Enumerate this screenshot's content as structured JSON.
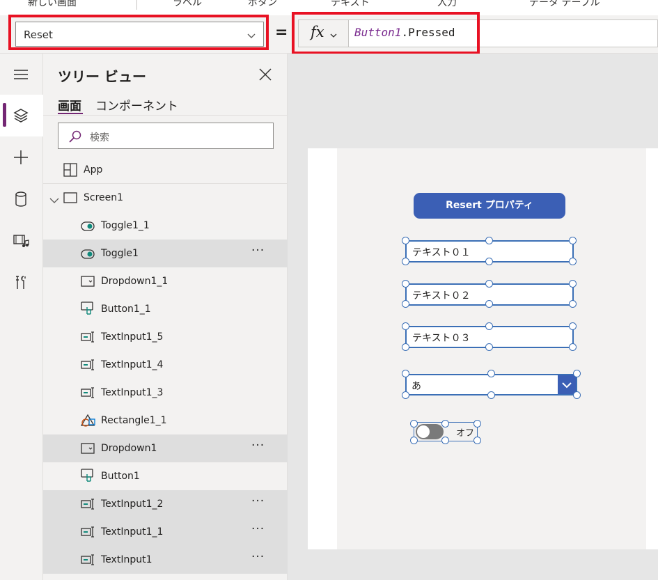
{
  "ribbon": {
    "items": [
      "新しい画面",
      "ラベル",
      "ボタン",
      "テキスト",
      "入力",
      "データ テーブル"
    ]
  },
  "formula_bar": {
    "property": "Reset",
    "equals": "=",
    "fx_label": "fx",
    "formula_control": "Button1",
    "formula_property": ".Pressed"
  },
  "rail": {
    "icons": [
      "hamburger-icon",
      "layers-icon",
      "plus-icon",
      "database-icon",
      "media-icon",
      "tools-icon"
    ]
  },
  "tree": {
    "title": "ツリー ビュー",
    "tab_screens": "画面",
    "tab_components": "コンポーネント",
    "search_placeholder": "検索",
    "app_label": "App",
    "screen_label": "Screen1",
    "dots": "···",
    "items": [
      {
        "label": "Toggle1_1",
        "icon": "toggle-icon"
      },
      {
        "label": "Toggle1",
        "icon": "toggle-icon"
      },
      {
        "label": "Dropdown1_1",
        "icon": "dropdown-icon"
      },
      {
        "label": "Button1_1",
        "icon": "button-icon"
      },
      {
        "label": "TextInput1_5",
        "icon": "textinput-icon"
      },
      {
        "label": "TextInput1_4",
        "icon": "textinput-icon"
      },
      {
        "label": "TextInput1_3",
        "icon": "textinput-icon"
      },
      {
        "label": "Rectangle1_1",
        "icon": "shapes-icon"
      },
      {
        "label": "Dropdown1",
        "icon": "dropdown-icon"
      },
      {
        "label": "Button1",
        "icon": "button-icon"
      },
      {
        "label": "TextInput1_2",
        "icon": "textinput-icon"
      },
      {
        "label": "TextInput1_1",
        "icon": "textinput-icon"
      },
      {
        "label": "TextInput1",
        "icon": "textinput-icon"
      }
    ]
  },
  "canvas": {
    "button_label": "Resert プロパティ",
    "text_inputs": [
      "テキスト０１",
      "テキスト０２",
      "テキスト０３"
    ],
    "dropdown_value": "あ",
    "toggle_label": "オフ"
  },
  "colors": {
    "highlight_red": "#e81123",
    "accent_purple": "#742774",
    "button_blue": "#3b5fb5"
  }
}
